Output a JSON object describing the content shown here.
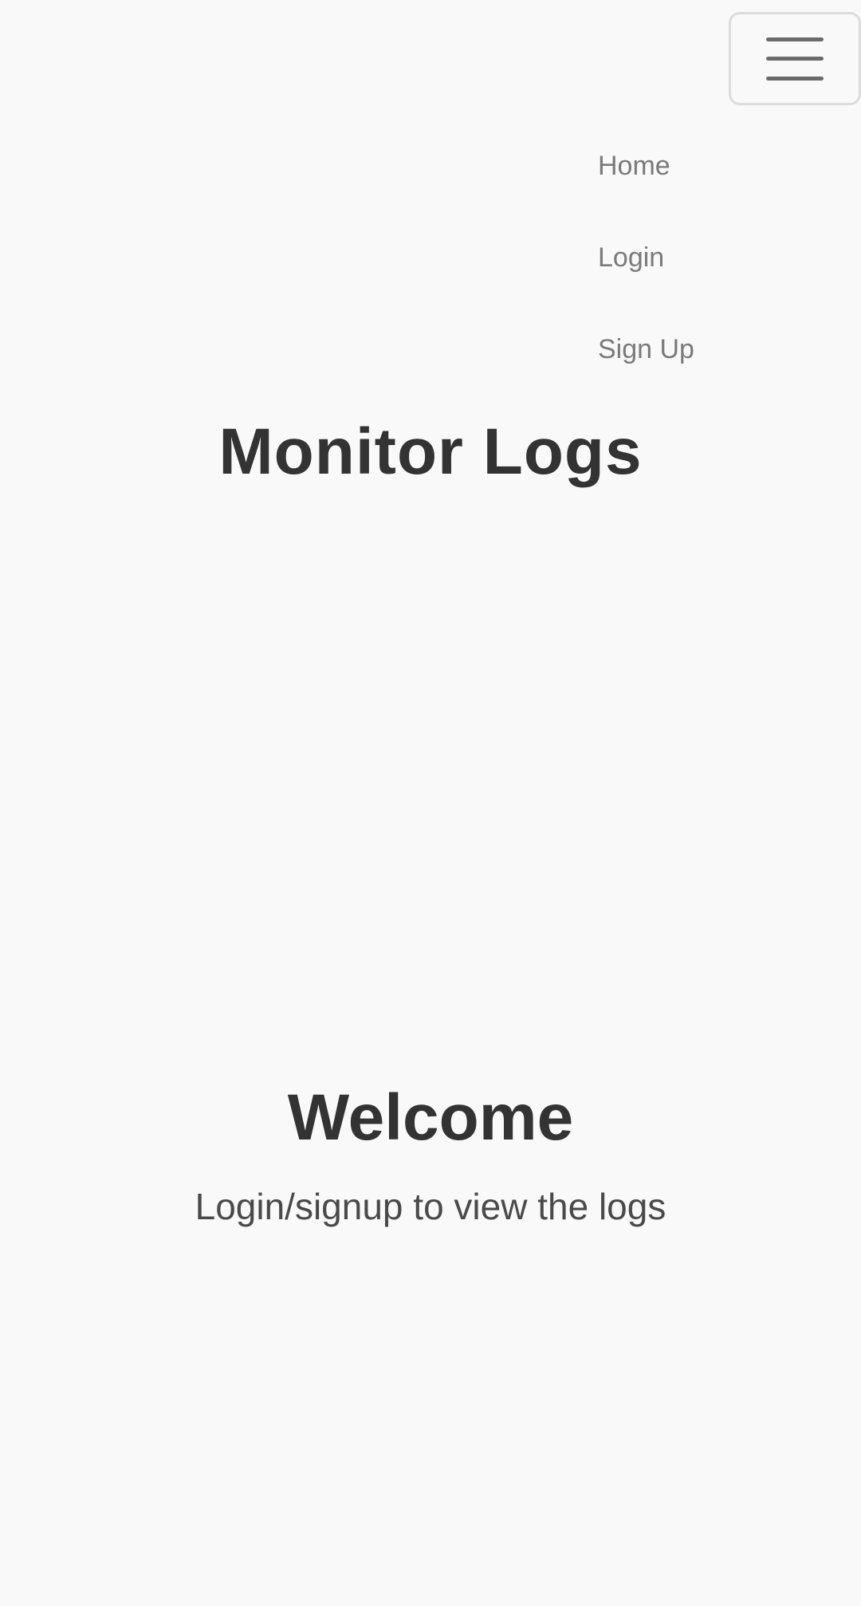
{
  "navbar": {
    "toggle_icon": "hamburger-menu-icon",
    "items": [
      {
        "label": "Home"
      },
      {
        "label": "Login"
      },
      {
        "label": "Sign Up"
      }
    ]
  },
  "header": {
    "title": "Monitor Logs"
  },
  "main": {
    "heading": "Welcome",
    "subheading": "Login/signup to view the logs"
  },
  "colors": {
    "background": "#f9f9f9",
    "text": "#333333",
    "nav_text": "#7a7a7a"
  }
}
